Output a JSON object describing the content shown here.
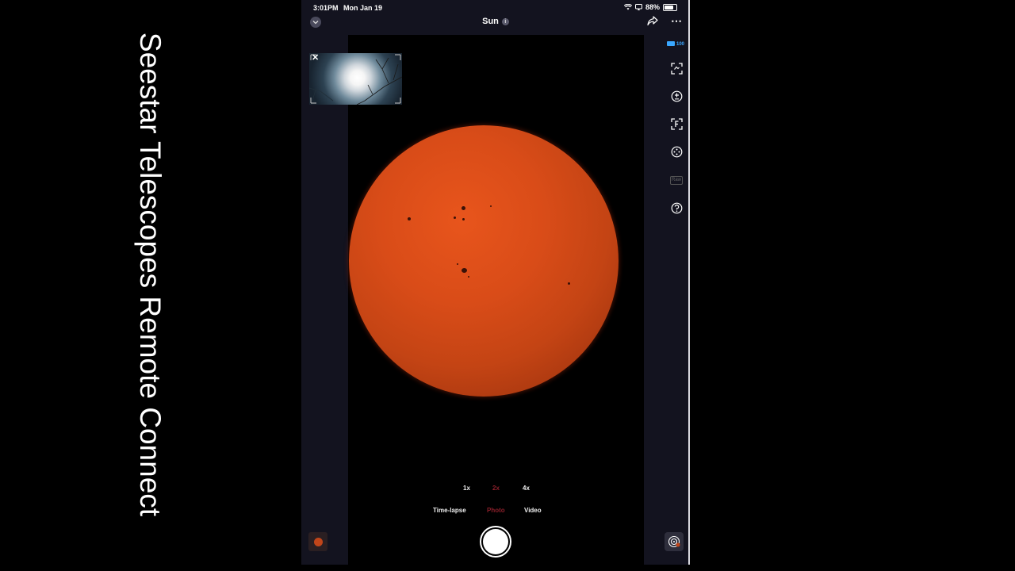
{
  "caption": "Seestar Telescopes Remote Connect",
  "status_bar": {
    "time": "3:01PM",
    "date": "Mon Jan 19",
    "battery": "88%",
    "battery_level": 0.88
  },
  "nav": {
    "title": "Sun",
    "info_icon": "info-icon",
    "share_icon": "share-icon",
    "more_icon": "more-icon",
    "collapse_icon": "chevron-down-icon"
  },
  "signal": {
    "value": "100"
  },
  "tools": [
    {
      "name": "reframe-icon"
    },
    {
      "name": "exposure-icon"
    },
    {
      "name": "focus-icon"
    },
    {
      "name": "crosshair-icon"
    },
    {
      "name": "raw-icon",
      "label": "Raw"
    },
    {
      "name": "help-icon"
    }
  ],
  "zoom": {
    "options": [
      "1x",
      "2x",
      "4x"
    ],
    "selected": "2x"
  },
  "modes": {
    "options": [
      "Time-lapse",
      "Photo",
      "Video"
    ],
    "selected": "Photo"
  },
  "colors": {
    "accent": "#8b1f2a",
    "sun": "#d94c18",
    "background": "#13131f",
    "signal": "#3aa7ff"
  }
}
